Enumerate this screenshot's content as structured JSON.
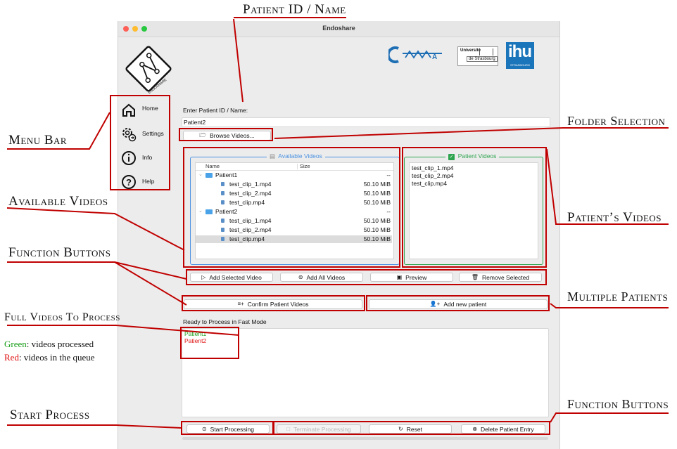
{
  "window": {
    "title": "Endoshare"
  },
  "logos": {
    "app": "ENDOSHARE",
    "cama": "CAMMA",
    "unistra_top": "Université",
    "unistra_bottom": "de Strasbourg",
    "ihu": "ihu",
    "ihu_sub": "STRASBOURG"
  },
  "nav": {
    "items": [
      {
        "label": "Home",
        "icon": "home-icon"
      },
      {
        "label": "Settings",
        "icon": "gear-icon"
      },
      {
        "label": "Info",
        "icon": "info-icon"
      },
      {
        "label": "Help",
        "icon": "help-icon"
      }
    ]
  },
  "patient": {
    "label": "Enter Patient ID / Name:",
    "value": "Patient2"
  },
  "browse_label": "Browse Videos...",
  "available": {
    "title": "Available Videos",
    "col_name": "Name",
    "col_size": "Size",
    "rows": [
      {
        "name": "Patient1",
        "size": "--"
      },
      {
        "name": "test_clip_1.mp4",
        "size": "50.10 MiB"
      },
      {
        "name": "test_clip_2.mp4",
        "size": "50.10 MiB"
      },
      {
        "name": "test_clip.mp4",
        "size": "50.10 MiB"
      },
      {
        "name": "Patient2",
        "size": "--"
      },
      {
        "name": "test_clip_1.mp4",
        "size": "50.10 MiB"
      },
      {
        "name": "test_clip_2.mp4",
        "size": "50.10 MiB"
      },
      {
        "name": "test_clip.mp4",
        "size": "50.10 MiB"
      }
    ]
  },
  "patient_videos": {
    "title": "Patient Videos",
    "items": [
      "test_clip_1.mp4",
      "test_clip_2.mp4",
      "test_clip.mp4"
    ]
  },
  "buttons": {
    "add_selected": "Add Selected Video",
    "add_all": "Add All Videos",
    "preview": "Preview",
    "remove_selected": "Remove Selected",
    "confirm": "Confirm Patient Videos",
    "add_patient": "Add new patient",
    "start": "Start Processing",
    "terminate": "Terminate Processing",
    "reset": "Reset",
    "delete": "Delete Patient Entry"
  },
  "queue": {
    "label": "Ready to Process in Fast Mode",
    "items": [
      {
        "name": "Patient1",
        "color": "#1a9e1a"
      },
      {
        "name": "Patient2",
        "color": "#e01010"
      }
    ]
  },
  "annotations": {
    "patient_id": "Patient ID / Name",
    "folder": "Folder Selection",
    "menu": "Menu Bar",
    "available": "Available Videos",
    "patients_videos": "Patient’s Videos",
    "function_buttons": "Function Buttons",
    "multiple": "Multiple Patients",
    "full_videos": "Full Videos To Process",
    "green_key": "Green",
    "green_desc": ": videos processed",
    "red_key": "Red",
    "red_desc": ":  videos in the queue",
    "start": "Start Process",
    "function_buttons_2": "Function Buttons"
  },
  "colors": {
    "accent_blue": "#4a90e2",
    "accent_green": "#2ea44f",
    "annotation_red": "#c00000"
  }
}
